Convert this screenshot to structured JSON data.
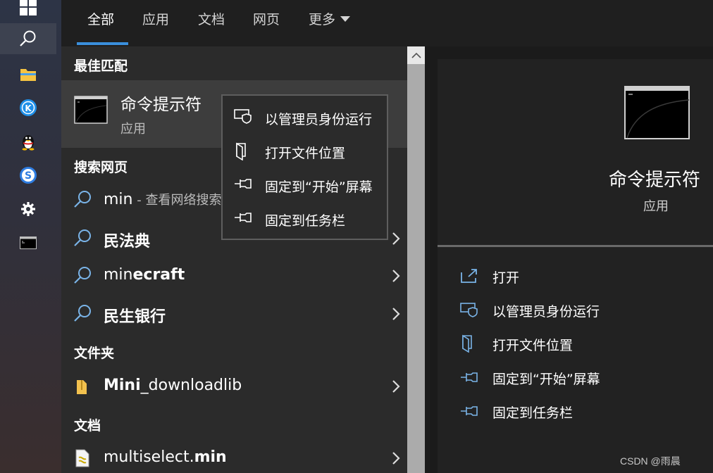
{
  "taskbar": {
    "items": [
      {
        "name": "windows-start"
      },
      {
        "name": "search"
      },
      {
        "name": "file-explorer"
      },
      {
        "name": "k-app"
      },
      {
        "name": "qq"
      },
      {
        "name": "sogou"
      },
      {
        "name": "settings"
      },
      {
        "name": "command-prompt"
      }
    ]
  },
  "tabs": [
    {
      "label": "全部",
      "active": true
    },
    {
      "label": "应用"
    },
    {
      "label": "文档"
    },
    {
      "label": "网页"
    },
    {
      "label": "更多"
    }
  ],
  "results": {
    "best_match_header": "最佳匹配",
    "best_match": {
      "title": "命令提示符",
      "subtitle": "应用"
    },
    "web_header": "搜索网页",
    "web_items": [
      {
        "prefix": "min",
        "suffix": " - 查看网络搜索结果"
      },
      {
        "text": "民法典"
      },
      {
        "plain": "min",
        "bold": "ecraft"
      },
      {
        "text": "民生银行"
      }
    ],
    "folder_header": "文件夹",
    "folder_item": {
      "bold": "Mini",
      "plain": "_downloadlib"
    },
    "docs_header": "文档",
    "doc_item": {
      "plain": "multiselect.",
      "bold": "min"
    }
  },
  "context_menu": {
    "items": [
      {
        "label": "以管理员身份运行",
        "icon": "shield-icon"
      },
      {
        "label": "打开文件位置",
        "icon": "file-location-icon"
      },
      {
        "label": "固定到“开始”屏幕",
        "icon": "pin-icon"
      },
      {
        "label": "固定到任务栏",
        "icon": "pin-icon"
      }
    ]
  },
  "preview": {
    "title": "命令提示符",
    "subtitle": "应用",
    "actions": [
      {
        "label": "打开",
        "icon": "open-icon"
      },
      {
        "label": "以管理员身份运行",
        "icon": "shield-icon"
      },
      {
        "label": "打开文件位置",
        "icon": "file-location-icon"
      },
      {
        "label": "固定到“开始”屏幕",
        "icon": "pin-icon"
      },
      {
        "label": "固定到任务栏",
        "icon": "pin-icon"
      }
    ]
  },
  "watermark": "CSDN @雨晨",
  "colors": {
    "accent": "#3a8fdc",
    "icon_blue": "#7ab4e8",
    "selected": "#3d3d3d"
  }
}
